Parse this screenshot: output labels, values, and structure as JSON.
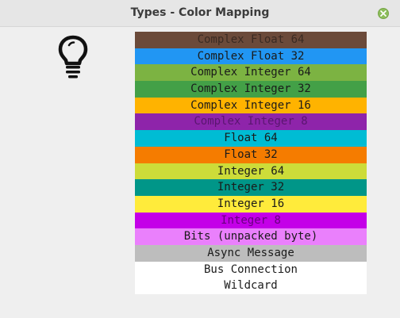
{
  "window": {
    "title": "Types - Color Mapping",
    "close_color": "#8cbd5a"
  },
  "icon": {
    "name": "lightbulb-icon"
  },
  "types": [
    {
      "label": "Complex Float 64",
      "bg": "#6b4a3a",
      "fg": "#3a2a22"
    },
    {
      "label": "Complex Float 32",
      "bg": "#2196f3",
      "fg": "#1a1a1a"
    },
    {
      "label": "Complex Integer 64",
      "bg": "#7cb342",
      "fg": "#1a1a1a"
    },
    {
      "label": "Complex Integer 32",
      "bg": "#43a047",
      "fg": "#1a1a1a"
    },
    {
      "label": "Complex Integer 16",
      "bg": "#ffb300",
      "fg": "#1a1a1a"
    },
    {
      "label": "Complex Integer 8",
      "bg": "#8e24aa",
      "fg": "#5a1670"
    },
    {
      "label": "Float 64",
      "bg": "#00bcd4",
      "fg": "#1a1a1a"
    },
    {
      "label": "Float 32",
      "bg": "#f57c00",
      "fg": "#1a1a1a"
    },
    {
      "label": "Integer 64",
      "bg": "#cddc39",
      "fg": "#1a1a1a"
    },
    {
      "label": "Integer 32",
      "bg": "#009688",
      "fg": "#1a1a1a"
    },
    {
      "label": "Integer 16",
      "bg": "#ffeb3b",
      "fg": "#1a1a1a"
    },
    {
      "label": "Integer 8",
      "bg": "#c400e8",
      "fg": "#6a0080"
    },
    {
      "label": "Bits (unpacked byte)",
      "bg": "#ea80fc",
      "fg": "#1a1a1a"
    },
    {
      "label": "Async Message",
      "bg": "#bdbdbd",
      "fg": "#1a1a1a"
    },
    {
      "label": "Bus Connection",
      "bg": "#ffffff",
      "fg": "#1a1a1a"
    },
    {
      "label": "Wildcard",
      "bg": "#ffffff",
      "fg": "#1a1a1a"
    }
  ]
}
